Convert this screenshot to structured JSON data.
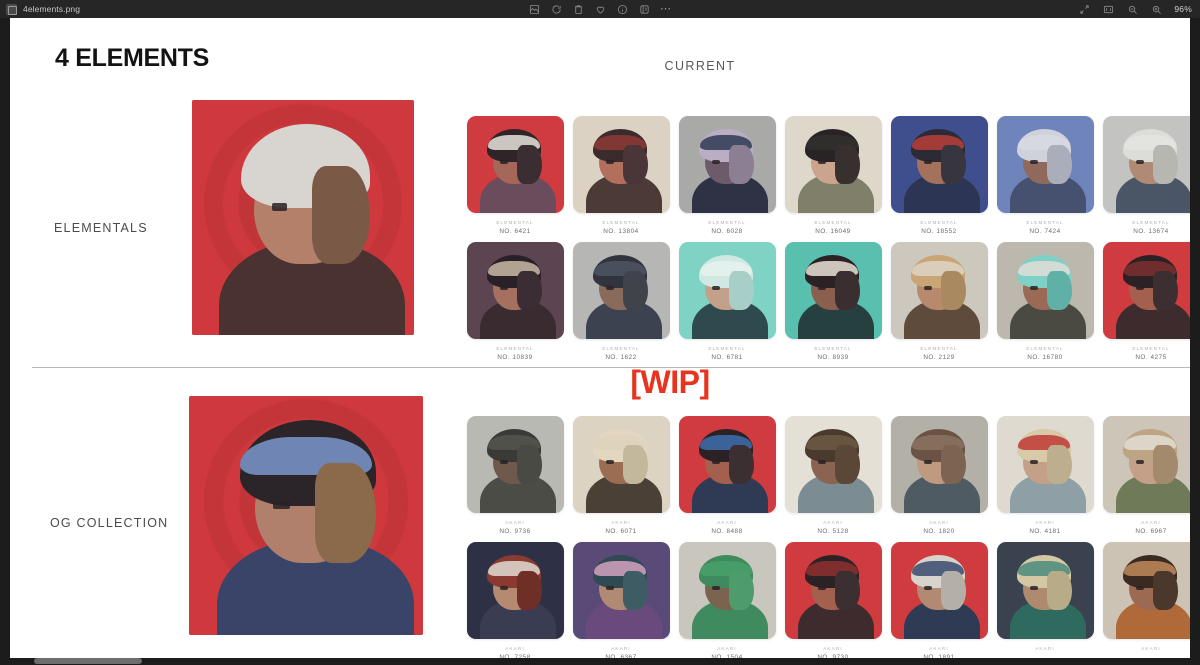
{
  "window": {
    "filename": "4elements.png",
    "app_icon": "image-file-icon",
    "toolbar_center": [
      {
        "name": "markup-icon",
        "label": "Markup"
      },
      {
        "name": "rotate-icon",
        "label": "Rotate"
      },
      {
        "name": "trash-icon",
        "label": "Delete"
      },
      {
        "name": "heart-icon",
        "label": "Favorite"
      },
      {
        "name": "info-icon",
        "label": "Info"
      },
      {
        "name": "share-icon",
        "label": "Share"
      },
      {
        "name": "more-icon",
        "label": "More"
      }
    ],
    "toolbar_right": [
      {
        "name": "expand-icon",
        "label": "Full Screen"
      },
      {
        "name": "fit-screen-icon",
        "label": "Fit to Screen"
      },
      {
        "name": "zoom-out-icon",
        "label": "Zoom Out"
      },
      {
        "name": "zoom-in-icon",
        "label": "Zoom In"
      }
    ],
    "zoom_level": "96%"
  },
  "document": {
    "title": "4 ELEMENTS",
    "current_label": "CURRENT",
    "wip_badge": "[WIP]",
    "wip_color": "#e8341f",
    "accent_red": "#cf383c",
    "sections": [
      {
        "label": "ELEMENTALS",
        "hero": {
          "name": "hero-elementals",
          "bg": "#cf383c"
        },
        "items": [
          {
            "kind": "ELEMENTAL",
            "no": "NO. 6421",
            "bg": "#cf3b3f",
            "skin": "#a4675a",
            "hair": "#2f2428",
            "hair2": "#3b2e33",
            "acc": "#e8e3dc",
            "body": "#6b4c5c"
          },
          {
            "kind": "ELEMENTAL",
            "no": "NO. 13804",
            "bg": "#dcd2c4",
            "skin": "#b2705c",
            "hair": "#3a2b2d",
            "hair2": "#4a3538",
            "acc": "#8e3a36",
            "body": "#4b3a35"
          },
          {
            "kind": "ELEMENTAL",
            "no": "NO. 6028",
            "bg": "#a9a9a8",
            "skin": "#6d5b6b",
            "hair": "#b9aec4",
            "hair2": "#8d7f93",
            "acc": "#2f3a54",
            "body": "#2e3244"
          },
          {
            "kind": "ELEMENTAL",
            "no": "NO. 16049",
            "bg": "#ded8ca",
            "skin": "#caa48c",
            "hair": "#2a2326",
            "hair2": "#37302f",
            "acc": "#31302f",
            "body": "#7f7f6a"
          },
          {
            "kind": "ELEMENTAL",
            "no": "NO. 18552",
            "bg": "#3f4f8d",
            "skin": "#a4725c",
            "hair": "#2b2a35",
            "hair2": "#37363f",
            "acc": "#b93f3a",
            "body": "#2c3554"
          },
          {
            "kind": "ELEMENTAL",
            "no": "NO. 7424",
            "bg": "#6f84bb",
            "skin": "#8f6a5c",
            "hair": "#cfd2da",
            "hair2": "#a9aeba",
            "acc": "#d7dae2",
            "body": "#46506f"
          },
          {
            "kind": "ELEMENTAL",
            "no": "NO. 13674",
            "bg": "#c3c3c1",
            "skin": "#b08a74",
            "hair": "#dcdcd8",
            "hair2": "#b7b7b2",
            "acc": "#e4e4e0",
            "body": "#4a5566"
          },
          {
            "kind": "ELEMENTAL",
            "no": "NO. 10839",
            "bg": "#5c4450",
            "skin": "#a6705f",
            "hair": "#2a2128",
            "hair2": "#3a2d34",
            "acc": "#c9b8a4",
            "body": "#3a2b30"
          },
          {
            "kind": "ELEMENTAL",
            "no": "NO. 1622",
            "bg": "#b6b6b4",
            "skin": "#8a6a5a",
            "hair": "#32343d",
            "hair2": "#41434c",
            "acc": "#4e5561",
            "body": "#3c4250"
          },
          {
            "kind": "ELEMENTAL",
            "no": "NO. 6781",
            "bg": "#7fd3c4",
            "skin": "#c3a08a",
            "hair": "#cfe8e2",
            "hair2": "#a8cfc7",
            "acc": "#e6f2ef",
            "body": "#2f4a4e"
          },
          {
            "kind": "ELEMENTAL",
            "no": "NO. 8939",
            "bg": "#59bfae",
            "skin": "#8a5f4e",
            "hair": "#2b2226",
            "hair2": "#3a2e31",
            "acc": "#e7e2d6",
            "body": "#26403f"
          },
          {
            "kind": "ELEMENTAL",
            "no": "NO. 2129",
            "bg": "#cdc8bd",
            "skin": "#b78a6e",
            "hair": "#c9a474",
            "hair2": "#a98a60",
            "acc": "#ddd6c8",
            "body": "#5e4b3c"
          },
          {
            "kind": "ELEMENTAL",
            "no": "NO. 16780",
            "bg": "#bdb8ae",
            "skin": "#9b6a54",
            "hair": "#7fd0c6",
            "hair2": "#5fb0a6",
            "acc": "#e0ded6",
            "body": "#4b4a42"
          },
          {
            "kind": "ELEMENTAL",
            "no": "NO. 4275",
            "bg": "#cf3b3f",
            "skin": "#a4604f",
            "hair": "#2c2226",
            "hair2": "#3c2f32",
            "acc": "#7c2f2f",
            "body": "#3d2b2e"
          }
        ]
      },
      {
        "label": "OG COLLECTION",
        "hero": {
          "name": "hero-og",
          "bg": "#cf383c"
        },
        "items": [
          {
            "kind": "AKARI",
            "no": "NO. 9736",
            "bg": "#b9b9b4",
            "skin": "#6f594c",
            "hair": "#3a3a36",
            "hair2": "#4a4a44",
            "acc": "#565650",
            "body": "#4c4c46"
          },
          {
            "kind": "AKARI",
            "no": "NO. 6071",
            "bg": "#dcd3c3",
            "skin": "#9b6e53",
            "hair": "#e3d8bf",
            "hair2": "#c4b89c",
            "acc": "#ddd3bd",
            "body": "#4b4036"
          },
          {
            "kind": "AKARI",
            "no": "NO. 8488",
            "bg": "#cf3b3f",
            "skin": "#a4604f",
            "hair": "#2c2226",
            "hair2": "#3c2f32",
            "acc": "#3f6fae",
            "body": "#2f3a54"
          },
          {
            "kind": "AKARI",
            "no": "NO. 5128",
            "bg": "#e4e0d6",
            "skin": "#8a6450",
            "hair": "#4a3a2e",
            "hair2": "#5a4738",
            "acc": "#6d5a42",
            "body": "#7b8c92"
          },
          {
            "kind": "AKARI",
            "no": "NO. 1820",
            "bg": "#b3b0a8",
            "skin": "#c09a80",
            "hair": "#6a5344",
            "hair2": "#7c6352",
            "acc": "#8a7460",
            "body": "#4e5b63"
          },
          {
            "kind": "AKARI",
            "no": "NO. 4181",
            "bg": "#dedad0",
            "skin": "#c4a088",
            "hair": "#d8c9a8",
            "hair2": "#bdae8e",
            "acc": "#c03a36",
            "body": "#8ea0a6"
          },
          {
            "kind": "AKARI",
            "no": "NO. 6967",
            "bg": "#cdc6b8",
            "skin": "#c4a088",
            "hair": "#bda484",
            "hair2": "#a38a6c",
            "acc": "#e2ded4",
            "body": "#6f7a58"
          },
          {
            "kind": "AKARI",
            "no": "NO. 7258",
            "bg": "#2e3046",
            "skin": "#b58a70",
            "hair": "#8a3a30",
            "hair2": "#6f2e26",
            "acc": "#e0dcd2",
            "body": "#3a3c52"
          },
          {
            "kind": "AKARI",
            "no": "NO. 6367",
            "bg": "#5a4a78",
            "skin": "#b08a72",
            "hair": "#2f4a52",
            "hair2": "#3d5c64",
            "acc": "#d4a2c0",
            "body": "#6a4a7c"
          },
          {
            "kind": "AKARI",
            "no": "NO. 1504",
            "bg": "#c9c6bd",
            "skin": "#7a6450",
            "hair": "#3f8a5e",
            "hair2": "#4e9c6c",
            "acc": "#49a06a",
            "body": "#3f8a5e"
          },
          {
            "kind": "AKARI",
            "no": "NO. 9730",
            "bg": "#cf3b3f",
            "skin": "#a4604f",
            "hair": "#2c2226",
            "hair2": "#3c2f32",
            "acc": "#8e2f2f",
            "body": "#3d2b2e"
          },
          {
            "kind": "AKARI",
            "no": "NO. 1891",
            "bg": "#cf3b3f",
            "skin": "#b28a74",
            "hair": "#d8d4cc",
            "hair2": "#b4b0a8",
            "acc": "#3a4a6e",
            "body": "#2f3a54"
          },
          {
            "kind": "AKARI",
            "no": "",
            "bg": "#3a4250",
            "skin": "#b08a6e",
            "hair": "#d4c8a4",
            "hair2": "#b7ab88",
            "acc": "#4a8a7c",
            "body": "#2f6a5e"
          },
          {
            "kind": "AKARI",
            "no": "",
            "bg": "#cdc3b4",
            "skin": "#9b6a50",
            "hair": "#3a2a22",
            "hair2": "#4a382c",
            "acc": "#c08a5a",
            "body": "#b06a3a"
          }
        ]
      }
    ]
  },
  "scrollbar": {
    "orientation": "horizontal",
    "name": "horizontal-scrollbar"
  }
}
